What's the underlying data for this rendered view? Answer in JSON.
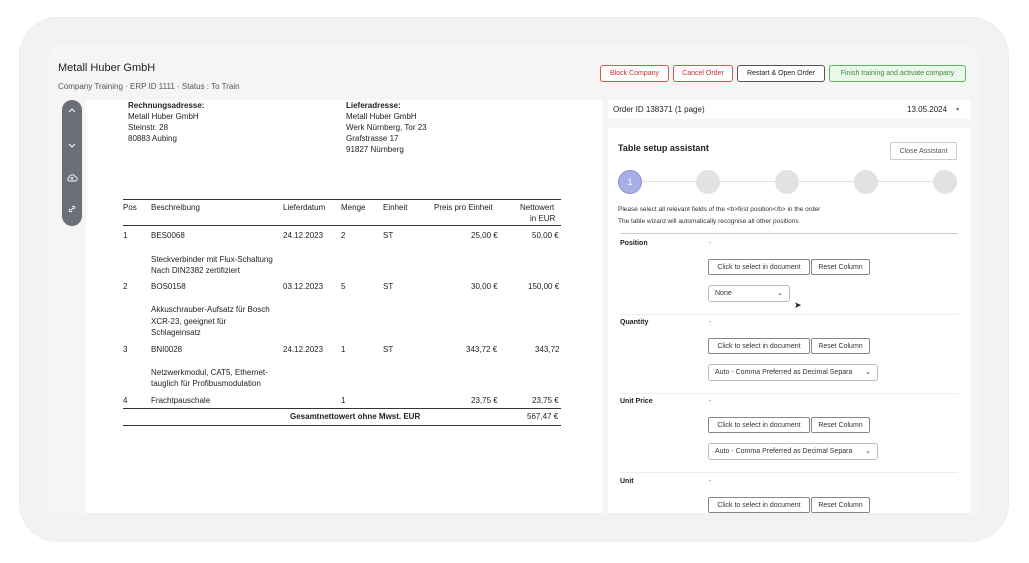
{
  "header": {
    "company": "Metall Huber GmbH",
    "subline": "Company Training · ERP ID 1111 · Status : To Train",
    "buttons": {
      "block": "Block Company",
      "cancel": "Cancel Order",
      "restart": "Restart & Open Order",
      "finish": "Finish training and activate company"
    }
  },
  "document": {
    "billing": {
      "title": "Rechnungsadresse:",
      "lines": [
        "Metall Huber GmbH",
        "Steinstr. 28",
        "80883 Aubing"
      ]
    },
    "delivery": {
      "title": "Lieferadresse:",
      "lines": [
        "Metall Huber GmbH",
        "Werk Nürnberg, Tor 23",
        "Grafstrasse 17",
        "91827 Nürnberg"
      ]
    },
    "columns": [
      "Pos",
      "Beschreibung",
      "Lieferdatum",
      "Menge",
      "Einheit",
      "Preis pro Einheit",
      "Nettowert",
      "in EUR"
    ],
    "rows": [
      {
        "pos": "1",
        "code": "BES0068",
        "date": "24.12.2023",
        "qty": "2",
        "unit": "ST",
        "price": "25,00 €",
        "net": "50,00 €",
        "desc": [
          "Steckverbinder mit Flux-Schaltung",
          "Nach DIN2382 zertifiziert"
        ]
      },
      {
        "pos": "2",
        "code": "BOS0158",
        "date": "03.12.2023",
        "qty": "5",
        "unit": "ST",
        "price": "30,00 €",
        "net": "150,00 €",
        "desc": [
          "Akkuschrauber-Aufsatz für Bosch",
          "XCR-23, geeignet für",
          "Schlageinsatz"
        ]
      },
      {
        "pos": "3",
        "code": "BNI0028",
        "date": "24.12.2023",
        "qty": "1",
        "unit": "ST",
        "price": "343,72 €",
        "net": "343,72",
        "desc": [
          "Netzwerkmodul, CAT5, Ethernet-",
          "tauglich für Profibusmodulation"
        ]
      },
      {
        "pos": "4",
        "code": "Frachtpauschale",
        "date": "",
        "qty": "1",
        "unit": "",
        "price": "23,75 €",
        "net": "23,75 €",
        "desc": []
      }
    ],
    "total_label": "Gesamtnettowert ohne Mwst. EUR",
    "total_value": "567,47 €"
  },
  "order": {
    "label": "Order ID 138371 (1 page)",
    "date": "13.05.2024"
  },
  "assistant": {
    "title": "Table setup assistant",
    "close": "Close Assistant",
    "step1": "1",
    "instructions": [
      "Please select all relevant fields of the <b>first position</b> in the order",
      "The table wizard will automatically recognise all other positions"
    ],
    "fields": [
      {
        "label": "Position",
        "value": "-",
        "select": "None"
      },
      {
        "label": "Quantity",
        "value": "-",
        "select": "Auto - Comma Preferred as Decimal Separa"
      },
      {
        "label": "Unit Price",
        "value": "-",
        "select": "Auto - Comma Preferred as Decimal Separa"
      },
      {
        "label": "Unit",
        "value": "-",
        "select": ""
      }
    ],
    "select_btn": "Click to select in document",
    "reset_btn": "Reset Column"
  },
  "icons": [
    "chevron-up-icon",
    "chevron-down-icon",
    "cloud-upload-icon",
    "link-icon",
    "caret-down-icon",
    "mouse-cursor-icon"
  ]
}
